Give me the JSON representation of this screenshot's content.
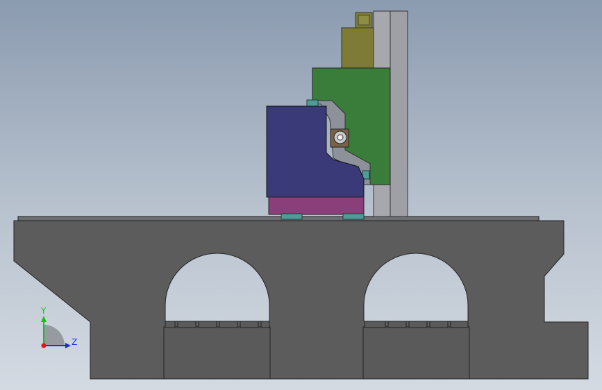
{
  "triad": {
    "y_label": "Y",
    "z_label": "Z",
    "y_color": "#12c21a",
    "z_color": "#1a2ee0",
    "origin_color": "#e01818"
  },
  "colors": {
    "background_top": "#8b9bb0",
    "background_bottom": "#d4dae2",
    "machine_bed": "#5c5c5c",
    "column_guide": "#a6a8ae",
    "spindle_carriage": "#3a7d3a",
    "motor": "#7d7b35",
    "saddle": "#3a3a78",
    "table_base": "#8a3f7a",
    "linear_guide_block": "#4f9c97"
  }
}
